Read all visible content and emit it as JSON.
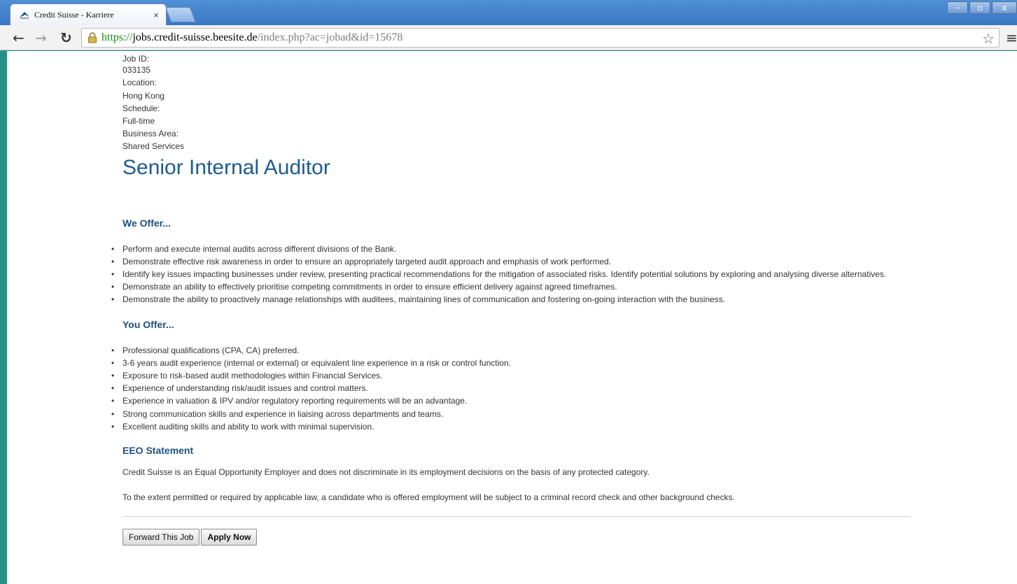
{
  "browser": {
    "tab_title": "Credit Suisse  -  Karriere",
    "tab_close": "×",
    "url_scheme": "https://",
    "url_host": "jobs.credit-suisse.beesite.de",
    "url_path": "/index.php?ac=jobad&id=15678",
    "window_controls": {
      "minimize": "–",
      "restore": "▫",
      "close": "x"
    }
  },
  "job_meta": [
    "Job ID:",
    "033135",
    "Location:",
    "Hong Kong",
    "Schedule:",
    "Full-time",
    "Business Area:",
    "Shared Services"
  ],
  "job_title": "Senior Internal Auditor",
  "we_offer": {
    "heading": "We Offer...",
    "items": [
      "Perform and execute internal audits across different divisions of the Bank.",
      "Demonstrate effective risk awareness in order to ensure an appropriately targeted audit approach and emphasis of work performed.",
      "Identify key issues impacting businesses under review, presenting practical recommendations for the mitigation of associated risks.  Identify potential solutions by exploring and analysing diverse alternatives.",
      "Demonstrate an ability to effectively prioritise competing commitments in order to ensure efficient delivery against agreed timeframes.",
      "Demonstrate the ability to proactively manage relationships with auditees, maintaining lines of communication and fostering on-going interaction with the business."
    ]
  },
  "you_offer": {
    "heading": "You Offer...",
    "items": [
      "Professional qualifications (CPA, CA) preferred.",
      "3-6 years audit experience (internal or external) or equivalent line experience in a risk or control function.",
      "Exposure to risk-based audit methodologies within Financial Services.",
      "Experience of understanding risk/audit issues and control matters.",
      "Experience in valuation & IPV and/or regulatory reporting requirements will be an advantage.",
      "Strong communication skills and experience in liaising across departments and teams.",
      "Excellent auditing skills and ability to work with minimal supervision."
    ]
  },
  "eeo": {
    "heading": "EEO Statement",
    "paragraph1": "Credit Suisse is an Equal Opportunity Employer and does not discriminate in its employment decisions on the basis of any protected category.",
    "paragraph2": "To the extent permitted or required by applicable law, a candidate who is offered employment will be subject to a criminal record check and other background checks."
  },
  "actions": {
    "forward_label": "Forward This Job",
    "apply_label": "Apply Now"
  },
  "colors": {
    "title_blue": "#1e5b8e",
    "heading_blue": "#1e4f80",
    "url_green": "#1b8c1b",
    "desktop_teal": "#2a8f86"
  },
  "icons": [
    "favicon-sail-icon",
    "back-arrow-icon",
    "forward-arrow-icon",
    "reload-icon",
    "lock-icon",
    "star-icon",
    "menu-icon"
  ]
}
